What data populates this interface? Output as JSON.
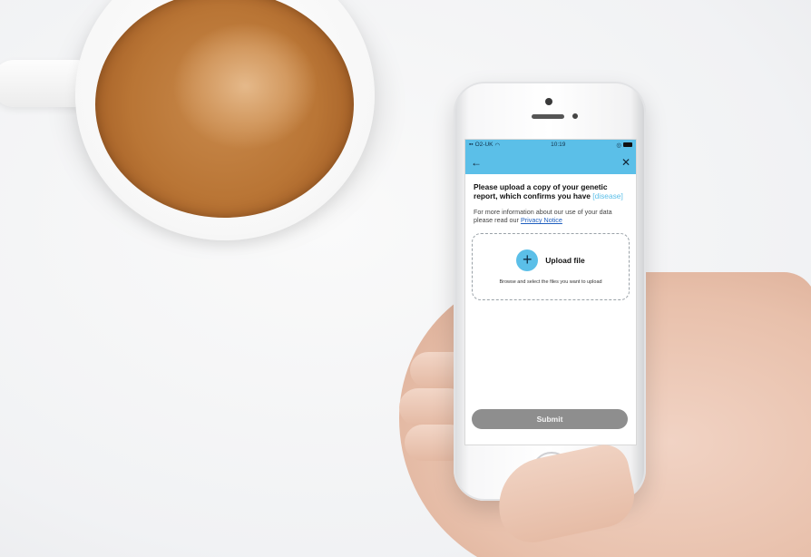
{
  "status_bar": {
    "carrier": "O2-UK",
    "time": "10:19"
  },
  "nav": {
    "back_icon": "←",
    "close_icon": "✕"
  },
  "content": {
    "heading": "Please upload a copy of your genetic report, which confirms you have",
    "heading_placeholder": "[disease]",
    "info_text": "For more information about our use of your data please read our",
    "privacy_link": "Privacy Notice"
  },
  "upload": {
    "plus_icon": "+",
    "title": "Upload file",
    "subtitle": "Browse and select the files you want to upload"
  },
  "submit_label": "Submit",
  "colors": {
    "accent": "#5bbfe8",
    "submit_disabled": "#8e8e8e",
    "link": "#1f5fbf"
  }
}
